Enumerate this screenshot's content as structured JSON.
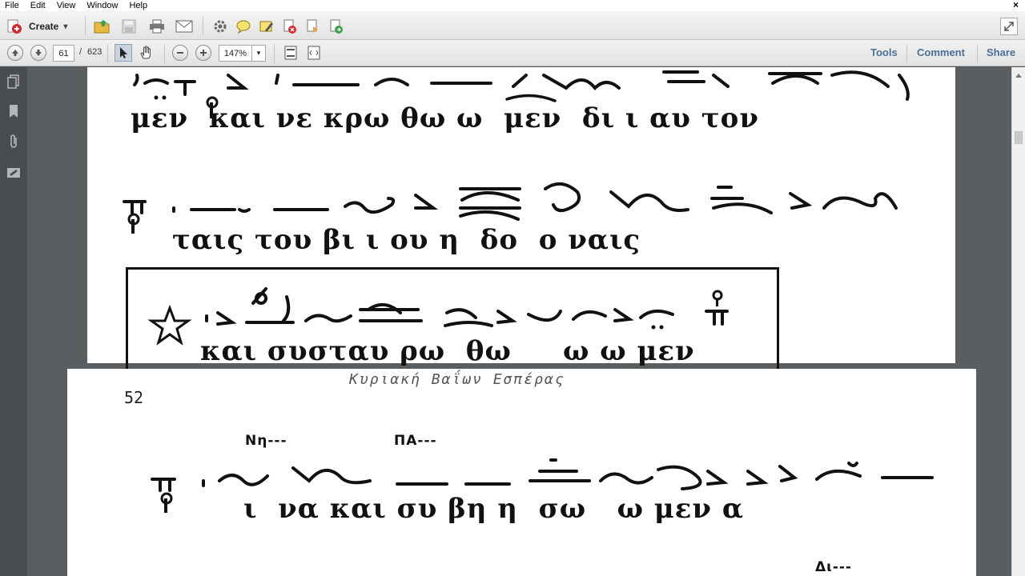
{
  "menu": {
    "items": [
      "File",
      "Edit",
      "View",
      "Window",
      "Help"
    ],
    "close_glyph": "×"
  },
  "toolbar": {
    "create_label": "Create",
    "create_dropdown": "▾",
    "icons": [
      "open-icon",
      "save-icon",
      "print-icon",
      "email-icon",
      "settings-icon",
      "comment-bubble-icon",
      "highlight-icon",
      "redact-icon",
      "stamp-icon",
      "export-icon",
      "expand-icon"
    ]
  },
  "nav": {
    "page_current": "61",
    "page_separator": "/",
    "page_total": "623",
    "zoom": "147%",
    "zoom_dropdown": "▾",
    "right_links": [
      "Tools",
      "Comment",
      "Share"
    ]
  },
  "document": {
    "page1": {
      "line1_lyrics": "μεν  και νε κρω θω ω  μεν  δι ι αυ τον",
      "line2_lyrics": "ταις του βι ι ου η  δο  ο ναις",
      "box_lyrics": "και συσταυ ρω  θω     ω ω μεν"
    },
    "page2": {
      "header": "Κυριακή  Βαΐων  Εσπέρας",
      "page_number": "52",
      "label_nh": "Nη---",
      "label_pa": "ΠΑ---",
      "label_di": "Δι---",
      "line1_lyrics": "ι  να και συ βη η  σω   ω μεν α"
    }
  },
  "colors": {
    "accent_link": "#4c6f97",
    "panel_dark": "#4a4d50",
    "doc_bg": "#5b5e61"
  }
}
